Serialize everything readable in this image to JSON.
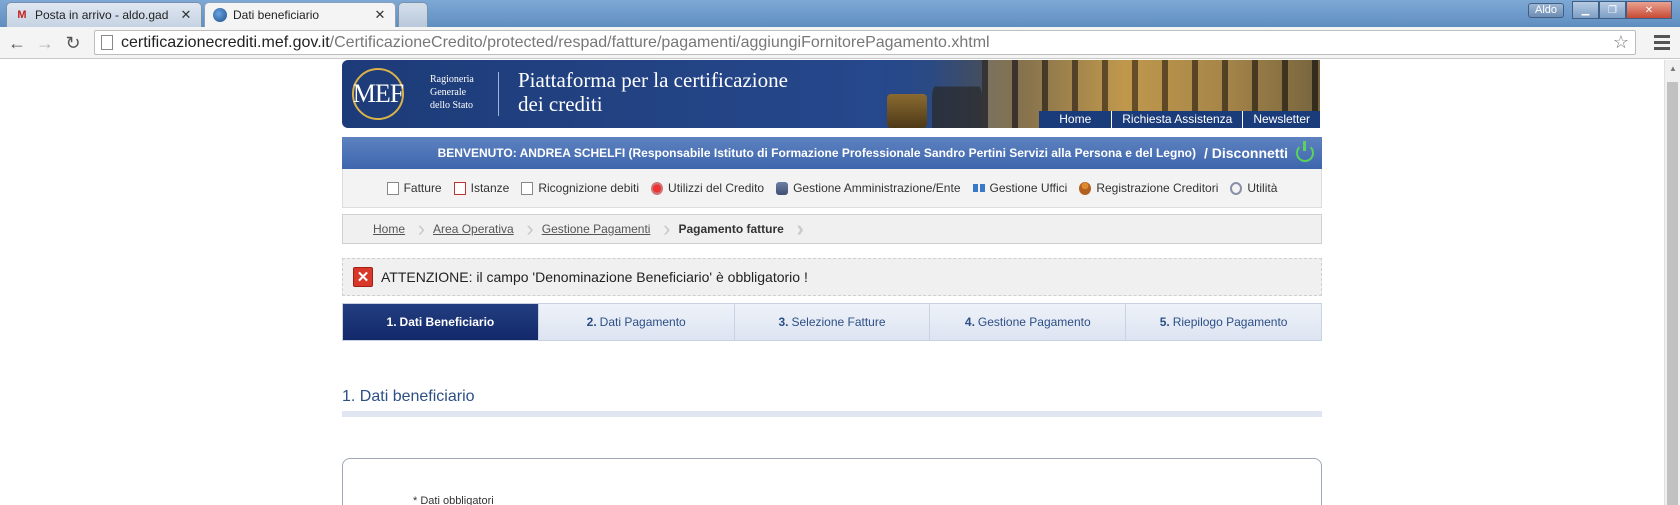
{
  "browser": {
    "tabs": [
      {
        "title": "Posta in arrivo - aldo.gad",
        "icon": "gmail-icon",
        "active": false
      },
      {
        "title": "Dati beneficiario",
        "icon": "globe-icon",
        "active": true
      }
    ],
    "user_badge": "Aldo",
    "url_domain": "certificazionecrediti.mef.gov.it",
    "url_path": "/CertificazioneCredito/protected/respad/fatture/pagamenti/aggiungiFornitorePagamento.xhtml"
  },
  "header": {
    "logo": "MEF",
    "org_lines": [
      "Ragioneria",
      "Generale",
      "dello Stato"
    ],
    "title_line1": "Piattaforma per la certificazione",
    "title_line2": "dei crediti",
    "links": [
      "Home",
      "Richiesta Assistenza",
      "Newsletter"
    ]
  },
  "welcome": {
    "text": "BENVENUTO: ANDREA SCHELFI (Responsabile Istituto di Formazione Professionale Sandro Pertini Servizi alla Persona e del Legno)",
    "logout": "/ Disconnetti"
  },
  "menu": [
    {
      "label": "Fatture",
      "icon": "document-icon"
    },
    {
      "label": "Istanze",
      "icon": "request-icon"
    },
    {
      "label": "Ricognizione debiti",
      "icon": "document-icon"
    },
    {
      "label": "Utilizzi del Credito",
      "icon": "medal-icon"
    },
    {
      "label": "Gestione Amministrazione/Ente",
      "icon": "database-icon"
    },
    {
      "label": "Gestione Uffici",
      "icon": "network-icon"
    },
    {
      "label": "Registrazione Creditori",
      "icon": "user-icon"
    },
    {
      "label": "Utilità",
      "icon": "gear-icon"
    }
  ],
  "breadcrumb": [
    "Home",
    "Area Operativa",
    "Gestione Pagamenti",
    "Pagamento fatture"
  ],
  "alert": {
    "message": "ATTENZIONE: il campo 'Denominazione Beneficiario' è obbligatorio !"
  },
  "steps": [
    {
      "num": "1.",
      "label": "Dati Beneficiario",
      "active": true
    },
    {
      "num": "2.",
      "label": "Dati Pagamento",
      "active": false
    },
    {
      "num": "3.",
      "label": "Selezione Fatture",
      "active": false
    },
    {
      "num": "4.",
      "label": "Gestione Pagamento",
      "active": false
    },
    {
      "num": "5.",
      "label": "Riepilogo Pagamento",
      "active": false
    }
  ],
  "section": {
    "title": "1. Dati beneficiario",
    "required_note": "* Dati obbligatori"
  }
}
